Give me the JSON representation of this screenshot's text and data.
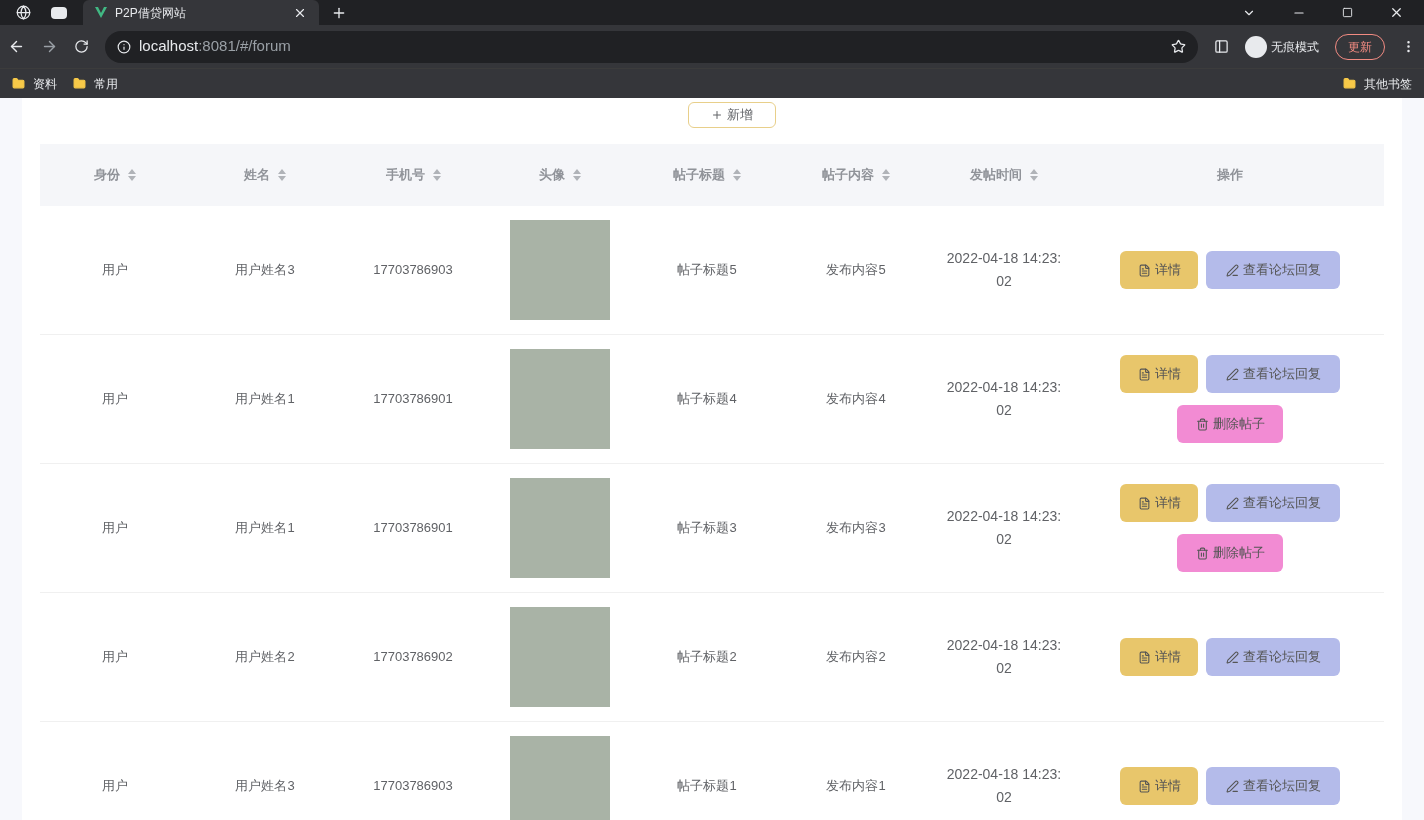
{
  "browser": {
    "tabs": [
      {
        "title": "P2P借贷网站",
        "selected": true
      }
    ],
    "url_host": "localhost",
    "url_rest": ":8081/#/forum",
    "incognito_label": "无痕模式",
    "update_label": "更新",
    "bookmarks": [
      "资料",
      "常用"
    ],
    "other_bookmarks": "其他书签"
  },
  "add_button": "新增",
  "table": {
    "columns": [
      {
        "label": "身份",
        "sortable": true
      },
      {
        "label": "姓名",
        "sortable": true
      },
      {
        "label": "手机号",
        "sortable": true
      },
      {
        "label": "头像",
        "sortable": true
      },
      {
        "label": "帖子标题",
        "sortable": true
      },
      {
        "label": "帖子内容",
        "sortable": true
      },
      {
        "label": "发帖时间",
        "sortable": true
      },
      {
        "label": "操作",
        "sortable": false
      }
    ],
    "rows": [
      {
        "role": "用户",
        "name": "用户姓名3",
        "phone": "17703786903",
        "title": "帖子标题5",
        "content": "发布内容5",
        "time": "2022-04-18 14:23:02",
        "actions": [
          {
            "kind": "detail",
            "label": "详情"
          },
          {
            "kind": "reply",
            "label": "查看论坛回复"
          }
        ]
      },
      {
        "role": "用户",
        "name": "用户姓名1",
        "phone": "17703786901",
        "title": "帖子标题4",
        "content": "发布内容4",
        "time": "2022-04-18 14:23:02",
        "actions": [
          {
            "kind": "detail",
            "label": "详情"
          },
          {
            "kind": "reply",
            "label": "查看论坛回复"
          },
          {
            "kind": "delete",
            "label": "删除帖子"
          }
        ]
      },
      {
        "role": "用户",
        "name": "用户姓名1",
        "phone": "17703786901",
        "title": "帖子标题3",
        "content": "发布内容3",
        "time": "2022-04-18 14:23:02",
        "actions": [
          {
            "kind": "detail",
            "label": "详情"
          },
          {
            "kind": "reply",
            "label": "查看论坛回复"
          },
          {
            "kind": "delete",
            "label": "删除帖子"
          }
        ]
      },
      {
        "role": "用户",
        "name": "用户姓名2",
        "phone": "17703786902",
        "title": "帖子标题2",
        "content": "发布内容2",
        "time": "2022-04-18 14:23:02",
        "actions": [
          {
            "kind": "detail",
            "label": "详情"
          },
          {
            "kind": "reply",
            "label": "查看论坛回复"
          }
        ]
      },
      {
        "role": "用户",
        "name": "用户姓名3",
        "phone": "17703786903",
        "title": "帖子标题1",
        "content": "发布内容1",
        "time": "2022-04-18 14:23:02",
        "actions": [
          {
            "kind": "detail",
            "label": "详情"
          },
          {
            "kind": "reply",
            "label": "查看论坛回复"
          }
        ]
      }
    ]
  }
}
